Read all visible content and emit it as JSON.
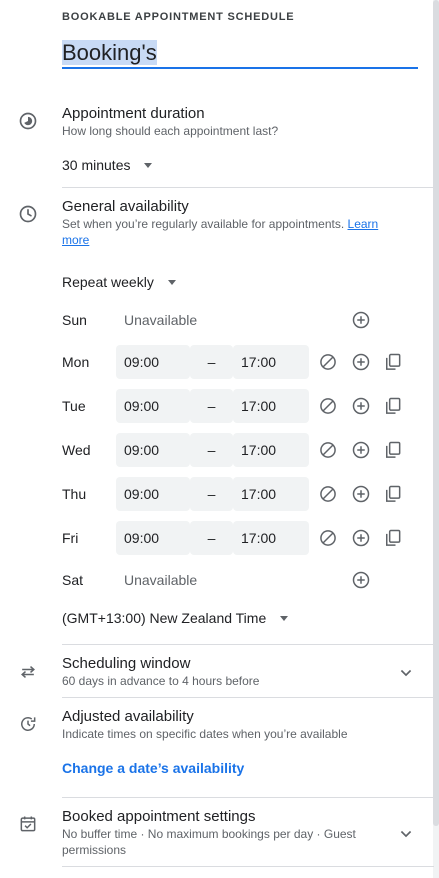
{
  "header": {
    "overline": "BOOKABLE APPOINTMENT SCHEDULE",
    "title_value": "Booking's"
  },
  "duration": {
    "title": "Appointment duration",
    "subtitle": "How long should each appointment last?",
    "value": "30 minutes"
  },
  "availability": {
    "title": "General availability",
    "subtitle": "Set when you’re regularly available for appointments.",
    "link_part1": "Learn",
    "link_part2": "more",
    "repeat": "Repeat weekly",
    "dash": "–",
    "days": [
      {
        "day": "Sun",
        "status": "Unavailable"
      },
      {
        "day": "Mon",
        "start": "09:00",
        "end": "17:00"
      },
      {
        "day": "Tue",
        "start": "09:00",
        "end": "17:00"
      },
      {
        "day": "Wed",
        "start": "09:00",
        "end": "17:00"
      },
      {
        "day": "Thu",
        "start": "09:00",
        "end": "17:00"
      },
      {
        "day": "Fri",
        "start": "09:00",
        "end": "17:00"
      },
      {
        "day": "Sat",
        "status": "Unavailable"
      }
    ],
    "timezone": "(GMT+13:00) New Zealand Time"
  },
  "scheduling_window": {
    "title": "Scheduling window",
    "subtitle": "60 days in advance to 4 hours before"
  },
  "adjusted": {
    "title": "Adjusted availability",
    "subtitle": "Indicate times on specific dates when you’re available",
    "link": "Change a date’s availability"
  },
  "booked": {
    "title": "Booked appointment settings",
    "subtitle_line1": "No buffer time · No maximum bookings per day · Guest",
    "subtitle_line2": "permissions"
  },
  "icons": {
    "duration": "timelapse-icon",
    "availability": "clock-icon",
    "scheduling": "swap-horiz-icon",
    "adjusted": "update-icon",
    "booked": "event-available-icon",
    "unavailable": "block-icon",
    "add": "add-circle-icon",
    "copy": "copy-icon",
    "expand": "chevron-down-icon"
  },
  "colors": {
    "accent": "#1a73e8",
    "selection": "#c8daf5",
    "timebox": "#f1f3f4",
    "icon": "#5f6368"
  }
}
